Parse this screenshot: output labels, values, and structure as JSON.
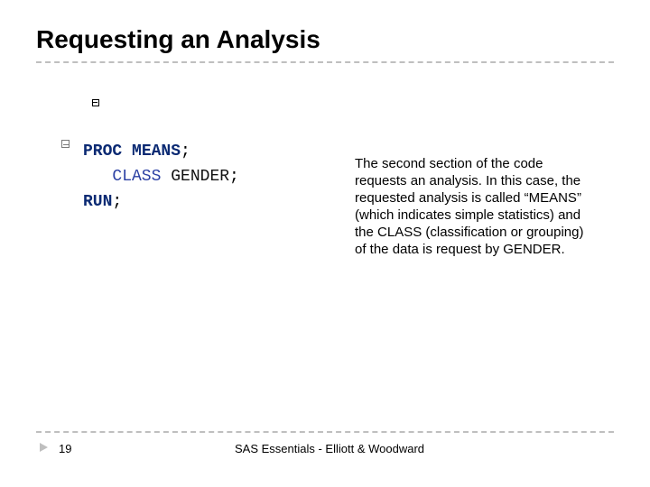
{
  "title": "Requesting an Analysis",
  "code": {
    "line1": {
      "proc": "PROC",
      "stmt": "MEANS",
      "semi": ";"
    },
    "line2": {
      "kw": "CLASS",
      "var": "GENDER",
      "semi": ";"
    },
    "line3": {
      "run": "RUN",
      "semi": ";"
    }
  },
  "explanation": "The second section of the code requests an analysis. In this case, the requested analysis is called “MEANS” (which indicates simple statistics) and the CLASS (classification or grouping) of the data is request by GENDER.",
  "footer": {
    "page": "19",
    "text": "SAS Essentials - Elliott & Woodward"
  }
}
